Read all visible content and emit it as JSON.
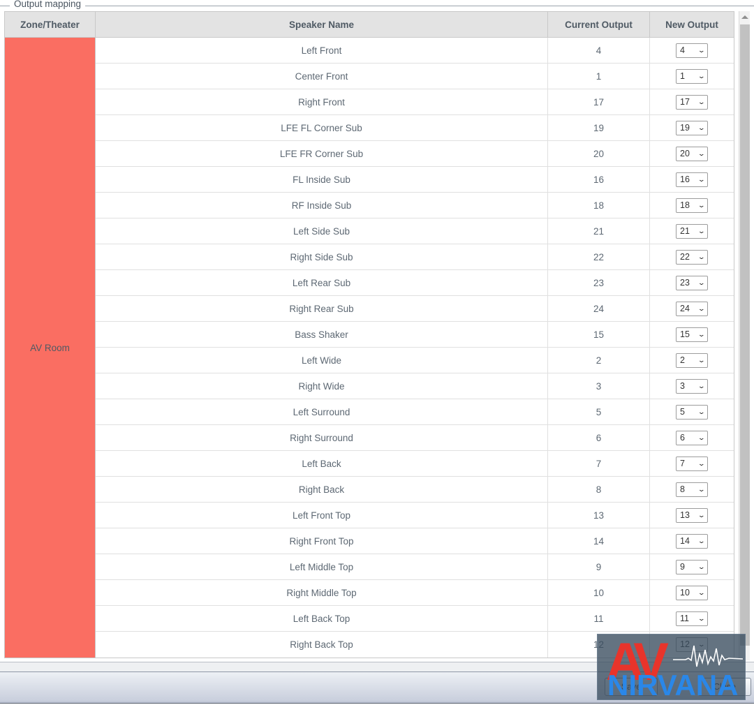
{
  "panel": {
    "legend": "Output mapping"
  },
  "table": {
    "columns": [
      {
        "key": "zone",
        "label": "Zone/Theater"
      },
      {
        "key": "name",
        "label": "Speaker Name"
      },
      {
        "key": "current",
        "label": "Current Output"
      },
      {
        "key": "new",
        "label": "New Output"
      }
    ],
    "zone_label": "AV Room",
    "zone_color": "#fa6e62",
    "rows": [
      {
        "name": "Left Front",
        "current": "4",
        "new": "4"
      },
      {
        "name": "Center Front",
        "current": "1",
        "new": "1"
      },
      {
        "name": "Right Front",
        "current": "17",
        "new": "17"
      },
      {
        "name": "LFE FL Corner Sub",
        "current": "19",
        "new": "19"
      },
      {
        "name": "LFE FR Corner Sub",
        "current": "20",
        "new": "20"
      },
      {
        "name": "FL Inside Sub",
        "current": "16",
        "new": "16"
      },
      {
        "name": "RF Inside Sub",
        "current": "18",
        "new": "18"
      },
      {
        "name": "Left Side Sub",
        "current": "21",
        "new": "21"
      },
      {
        "name": "Right Side Sub",
        "current": "22",
        "new": "22"
      },
      {
        "name": "Left Rear Sub",
        "current": "23",
        "new": "23"
      },
      {
        "name": "Right Rear Sub",
        "current": "24",
        "new": "24"
      },
      {
        "name": "Bass Shaker",
        "current": "15",
        "new": "15"
      },
      {
        "name": "Left Wide",
        "current": "2",
        "new": "2"
      },
      {
        "name": "Right Wide",
        "current": "3",
        "new": "3"
      },
      {
        "name": "Left Surround",
        "current": "5",
        "new": "5"
      },
      {
        "name": "Right Surround",
        "current": "6",
        "new": "6"
      },
      {
        "name": "Left Back",
        "current": "7",
        "new": "7"
      },
      {
        "name": "Right Back",
        "current": "8",
        "new": "8"
      },
      {
        "name": "Left Front Top",
        "current": "13",
        "new": "13"
      },
      {
        "name": "Right Front Top",
        "current": "14",
        "new": "14"
      },
      {
        "name": "Left Middle Top",
        "current": "9",
        "new": "9"
      },
      {
        "name": "Right Middle Top",
        "current": "10",
        "new": "10"
      },
      {
        "name": "Left Back Top",
        "current": "11",
        "new": "11"
      },
      {
        "name": "Right Back Top",
        "current": "12",
        "new": "12"
      }
    ]
  },
  "scrollbar": {
    "up_arrow_icon": "triangle-up-icon"
  },
  "footer": {
    "save_label": "Save",
    "close_label": "Close"
  },
  "watermark": {
    "monogram": "AV",
    "wordmark": "NIRVANA",
    "monogram_color": "#e8342b",
    "wordmark_color": "#2a87e8"
  }
}
